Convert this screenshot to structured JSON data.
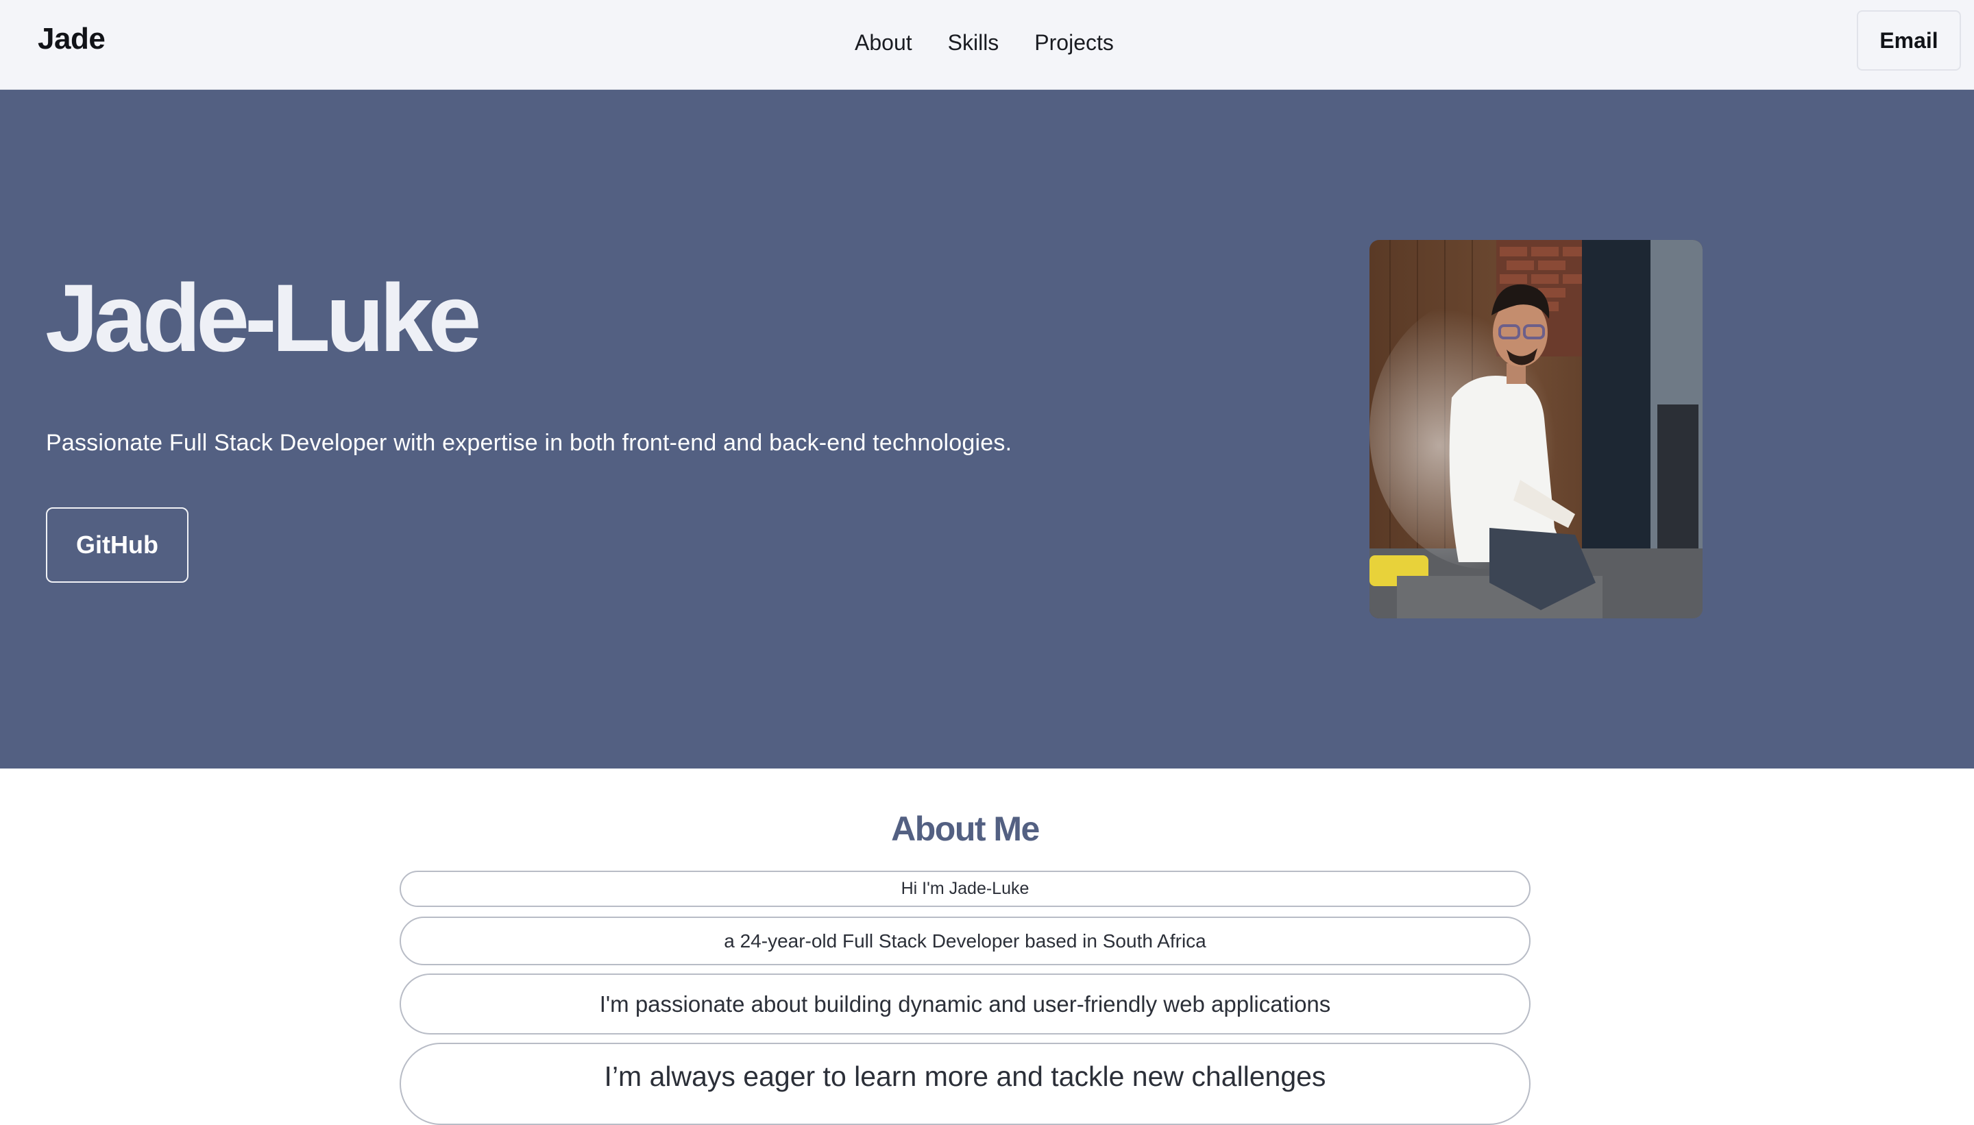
{
  "nav": {
    "brand": "Jade",
    "links": [
      "About",
      "Skills",
      "Projects"
    ],
    "email_label": "Email"
  },
  "hero": {
    "title": "Jade-Luke",
    "subtitle": "Passionate Full Stack Developer with expertise in both front-end and back-end technologies.",
    "github_label": "GitHub"
  },
  "about": {
    "title": "About Me",
    "lines": [
      "Hi I'm Jade-Luke",
      "a 24-year-old Full Stack Developer based in South Africa",
      "I'm passionate about building dynamic and user-friendly web applications",
      "I’m always eager to learn more and tackle new challenges"
    ]
  },
  "colors": {
    "hero_background": "#536082",
    "navbar_background": "#f4f5f9",
    "accent": "#536082"
  }
}
